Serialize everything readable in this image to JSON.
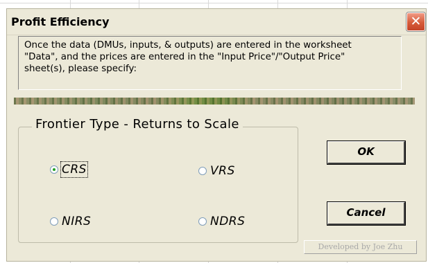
{
  "dialog": {
    "title": "Profit Efficiency",
    "close_glyph": "✕",
    "close_icon": "close-icon"
  },
  "info": {
    "line1": "Once the data (DMUs, inputs, & outputs) are entered in the worksheet",
    "line2": "\"Data\",  and the prices are entered in the \"Input Price\"/\"Output Price\"",
    "line3": "sheet(s), please specify:"
  },
  "frontier": {
    "legend": "Frontier Type - Returns to Scale",
    "options": [
      {
        "label": "CRS",
        "checked": true
      },
      {
        "label": "VRS",
        "checked": false
      },
      {
        "label": "NIRS",
        "checked": false
      },
      {
        "label": "NDRS",
        "checked": false
      }
    ]
  },
  "buttons": {
    "ok_label": "OK",
    "cancel_label": "Cancel"
  },
  "credit": {
    "text": "Developed by Joe Zhu"
  }
}
